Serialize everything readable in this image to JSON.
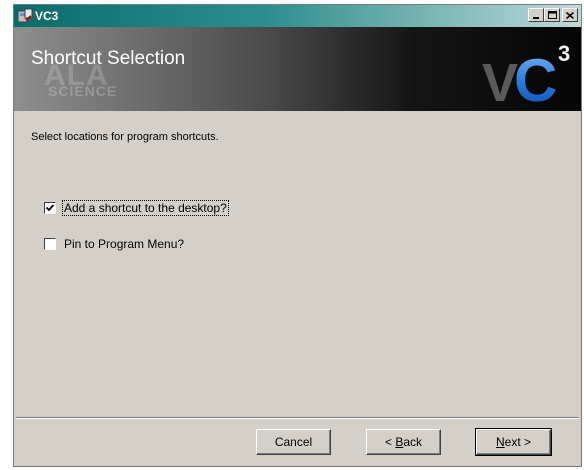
{
  "window": {
    "title": "VC3"
  },
  "banner": {
    "title": "Shortcut Selection",
    "watermark_top": "ALA",
    "watermark_bottom": "SCIENCE",
    "logo_text": "VC",
    "logo_super": "3"
  },
  "content": {
    "description": "Select locations for program shortcuts."
  },
  "options": [
    {
      "label": "Add a shortcut to the desktop?",
      "checked": true
    },
    {
      "label": "Pin to Program Menu?",
      "checked": false
    }
  ],
  "buttons": {
    "cancel": "Cancel",
    "back_prefix": "< ",
    "back_mnemonic": "B",
    "back_rest": "ack",
    "next_mnemonic": "N",
    "next_rest": "ext >"
  },
  "colors": {
    "titlebar": "#0c6b6b",
    "logo_blue": "#1e6fd0",
    "dialog_bg": "#d4d0c8"
  }
}
